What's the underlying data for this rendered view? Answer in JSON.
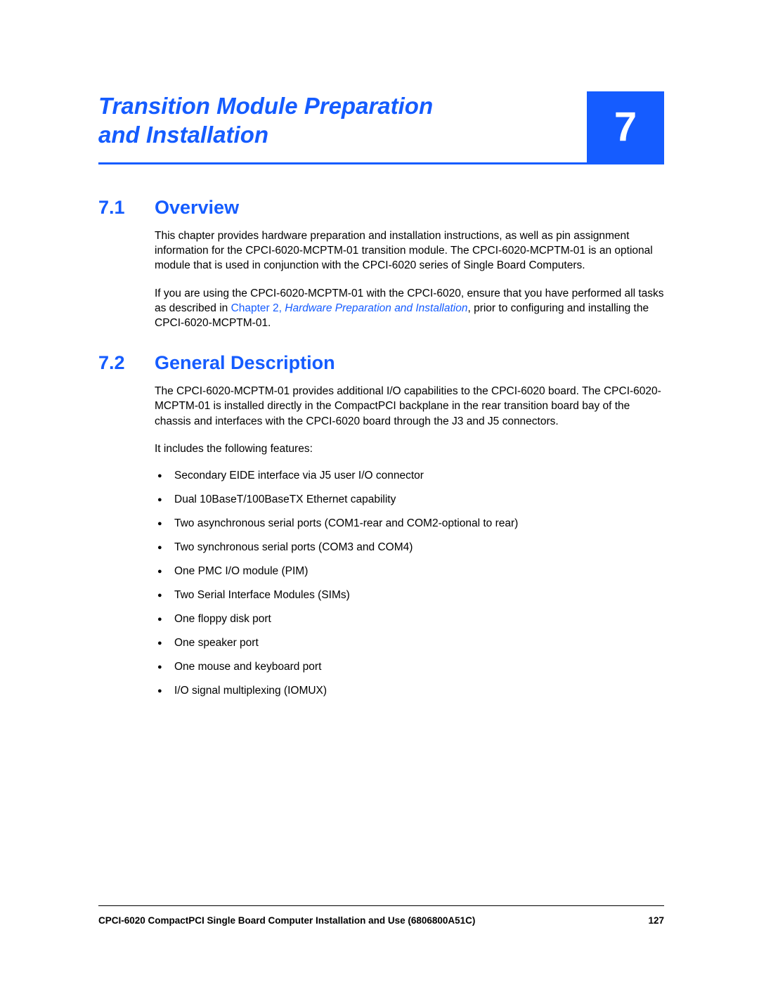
{
  "chapter": {
    "title": "Transition Module Preparation and Installation",
    "number": "7"
  },
  "sections": [
    {
      "num": "7.1",
      "title": "Overview",
      "paragraphs": [
        {
          "pre": "This chapter provides hardware preparation and installation instructions, as well as pin assignment information for the CPCI-6020-MCPTM-01 transition module. The CPCI-6020-MCPTM-01 is an optional module that is used in conjunction with the CPCI-6020 series of Single Board Computers."
        },
        {
          "pre": "If you are using the CPCI-6020-MCPTM-01 with the CPCI-6020, ensure that you have performed all tasks as described in ",
          "xref_plain": "Chapter 2, ",
          "xref_italic": "Hardware Preparation and Installation",
          "post": ", prior to configuring and installing the CPCI-6020-MCPTM-01."
        }
      ]
    },
    {
      "num": "7.2",
      "title": "General Description",
      "paragraphs": [
        {
          "pre": "The CPCI-6020-MCPTM-01 provides additional I/O capabilities to the CPCI-6020 board. The CPCI-6020-MCPTM-01 is installed directly in the CompactPCI backplane in the rear transition board bay of the chassis and interfaces with the CPCI-6020 board through the J3 and J5 connectors."
        },
        {
          "pre": "It includes the following features:"
        }
      ],
      "features": [
        "Secondary EIDE interface via J5 user I/O connector",
        "Dual 10BaseT/100BaseTX Ethernet capability",
        "Two asynchronous serial ports (COM1-rear and COM2-optional to rear)",
        "Two synchronous serial ports (COM3 and COM4)",
        "One PMC I/O module (PIM)",
        "Two Serial Interface Modules (SIMs)",
        "One floppy disk port",
        "One speaker port",
        "One mouse and keyboard port",
        "I/O signal multiplexing (IOMUX)"
      ]
    }
  ],
  "footer": {
    "doc_title": "CPCI-6020 CompactPCI Single Board Computer Installation and Use (6806800A51C)",
    "page_number": "127"
  }
}
